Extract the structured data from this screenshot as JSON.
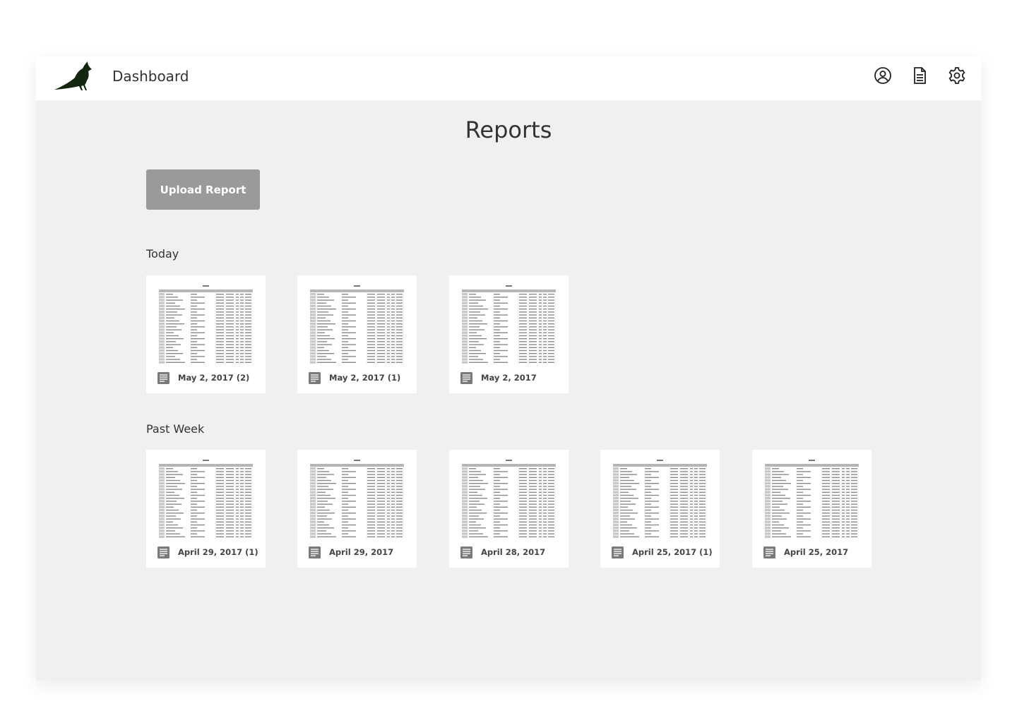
{
  "header": {
    "app_title": "Dashboard",
    "icons": [
      "profile-icon",
      "document-icon",
      "settings-icon"
    ]
  },
  "page": {
    "title": "Reports",
    "upload_button": "Upload Report"
  },
  "sections": [
    {
      "label": "Today",
      "reports": [
        {
          "name": "May 2, 2017 (2)",
          "icon": "document-icon"
        },
        {
          "name": "May 2, 2017 (1)",
          "icon": "document-icon"
        },
        {
          "name": "May 2, 2017",
          "icon": "document-icon"
        }
      ]
    },
    {
      "label": "Past Week",
      "reports": [
        {
          "name": "April 29, 2017 (1)",
          "icon": "document-icon"
        },
        {
          "name": "April 29, 2017",
          "icon": "document-icon"
        },
        {
          "name": "April 28, 2017",
          "icon": "document-icon"
        },
        {
          "name": "April 25, 2017 (1)",
          "icon": "document-icon"
        },
        {
          "name": "April 25, 2017",
          "icon": "document-icon"
        }
      ]
    }
  ],
  "colors": {
    "background": "#f0f0f0",
    "topbar": "#ffffff",
    "button": "#9a9a9a",
    "logo": "#13250f",
    "text": "#333333"
  }
}
